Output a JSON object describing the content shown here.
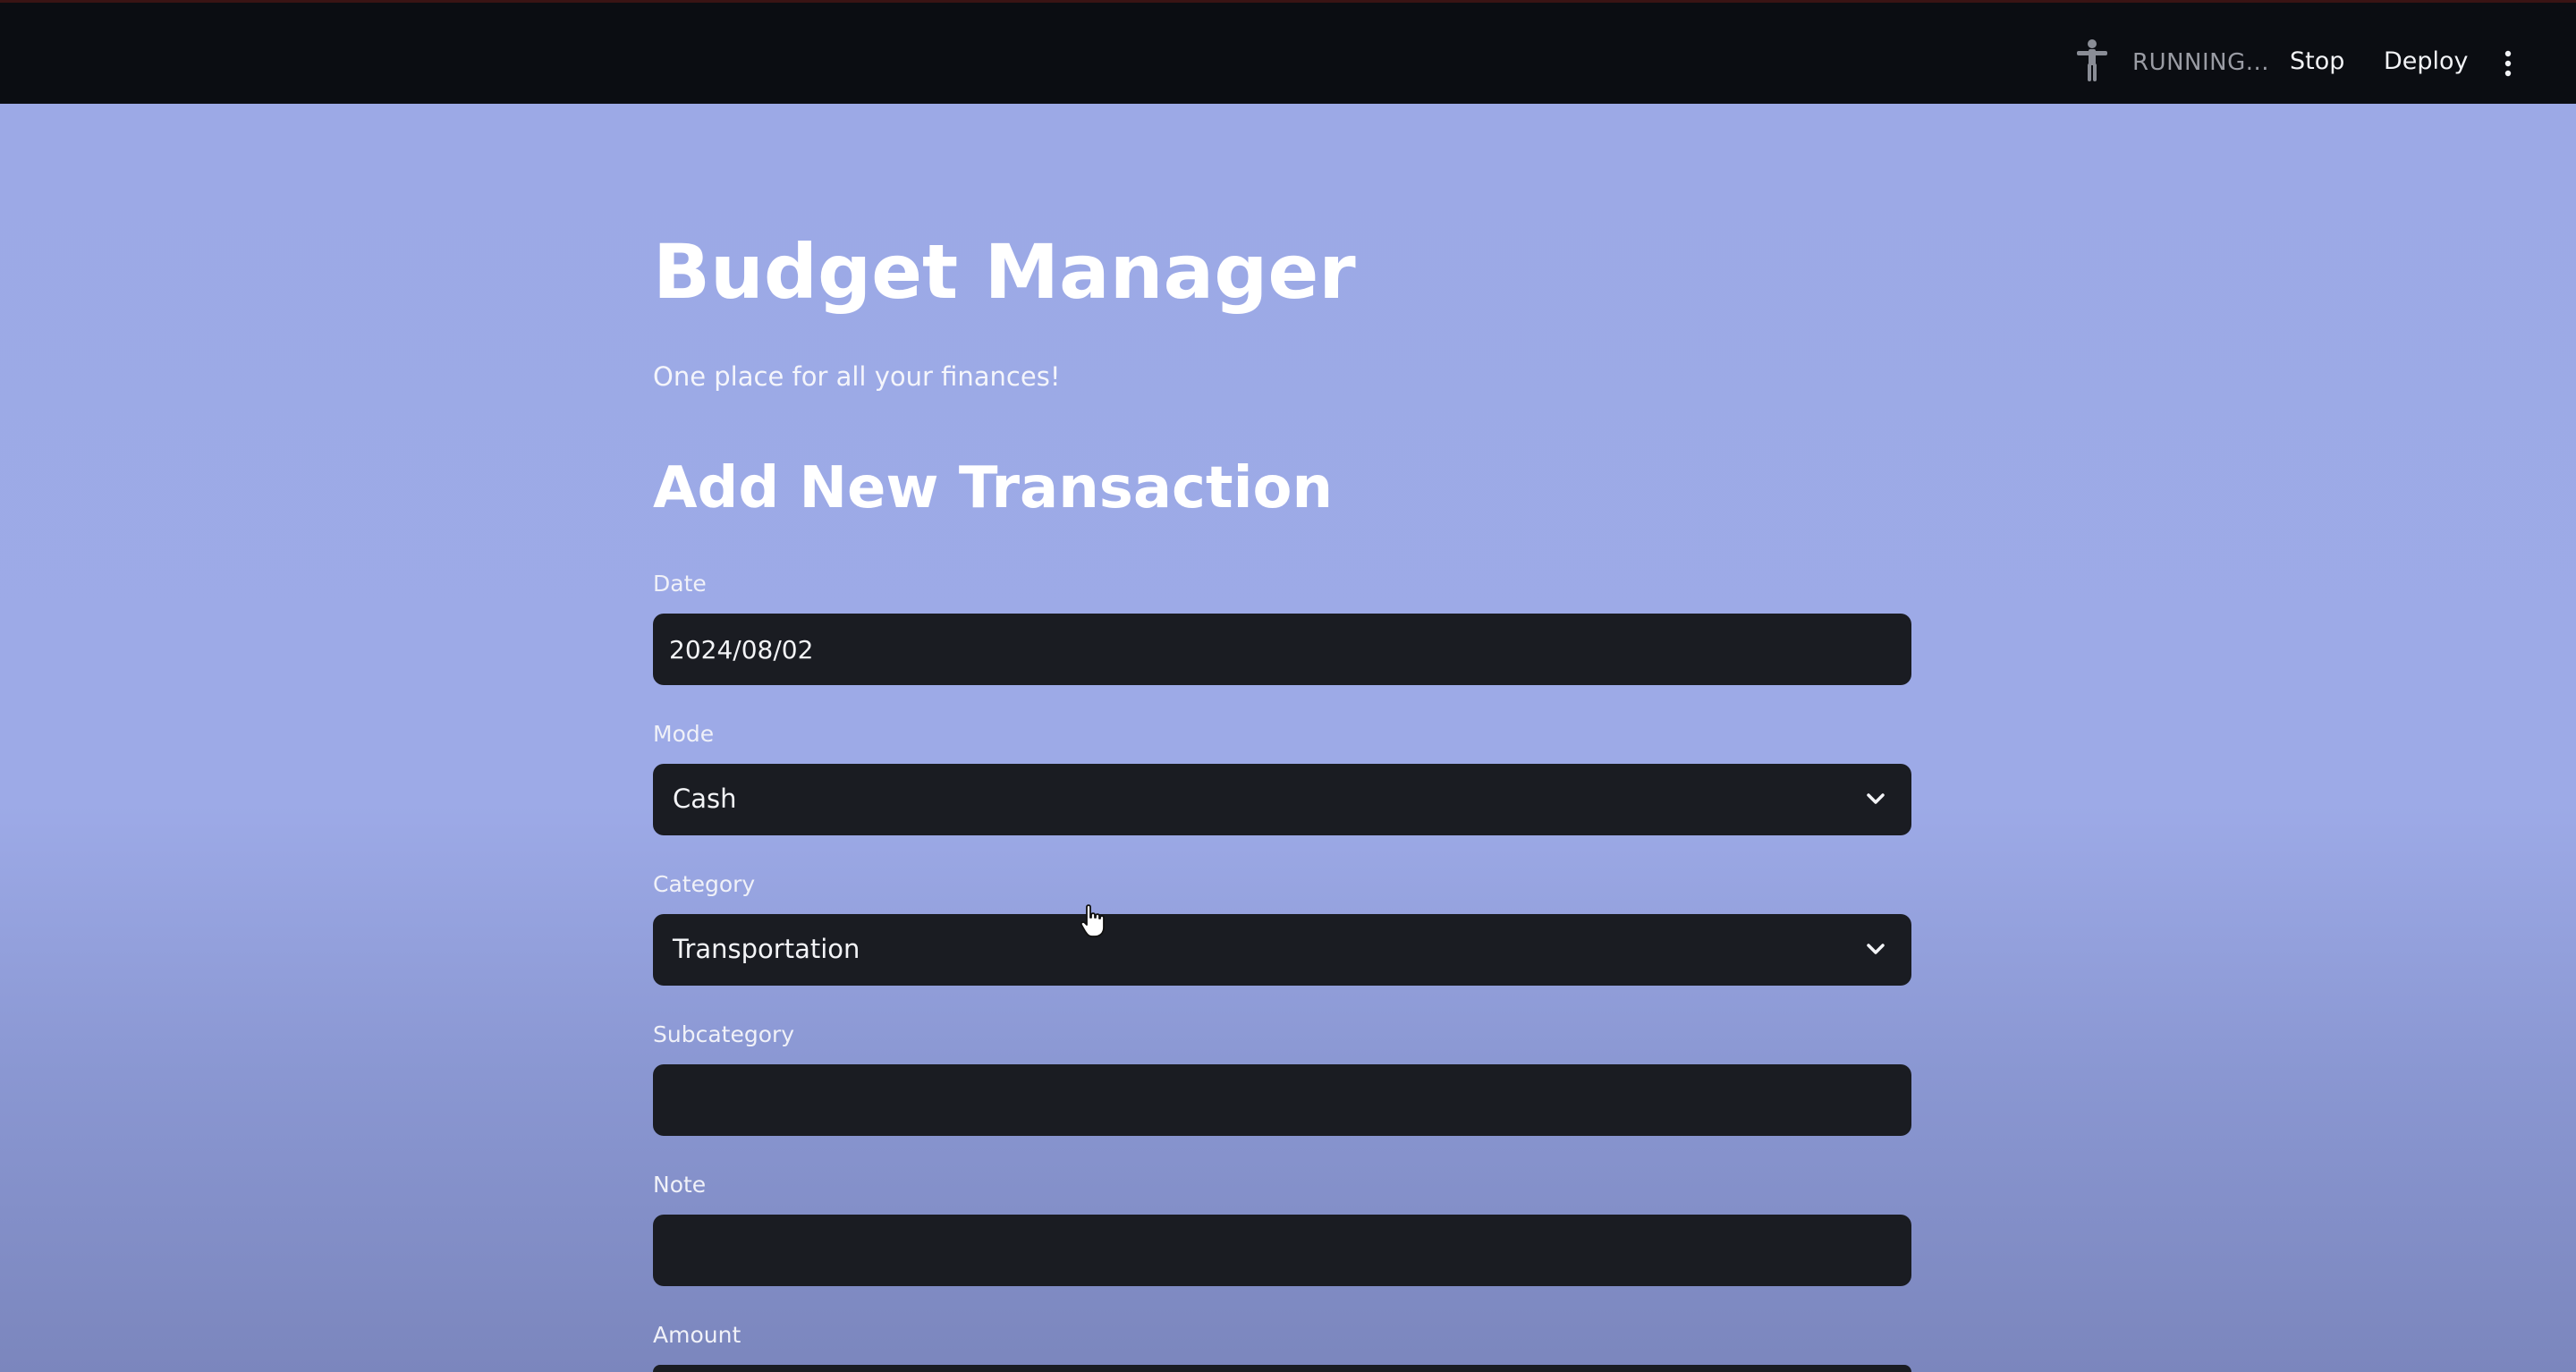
{
  "toolbar": {
    "status_icon": "running-figure-icon",
    "status_text": "RUNNING...",
    "stop_label": "Stop",
    "deploy_label": "Deploy",
    "menu_icon": "vertical-ellipsis-icon"
  },
  "app": {
    "title": "Budget Manager",
    "subtitle": "One place for all your finances!"
  },
  "form": {
    "heading": "Add New Transaction",
    "date": {
      "label": "Date",
      "value": "2024/08/02"
    },
    "mode": {
      "label": "Mode",
      "value": "Cash"
    },
    "category": {
      "label": "Category",
      "value": "Transportation"
    },
    "subcategory": {
      "label": "Subcategory",
      "value": ""
    },
    "note": {
      "label": "Note",
      "value": ""
    },
    "amount": {
      "label": "Amount"
    }
  }
}
